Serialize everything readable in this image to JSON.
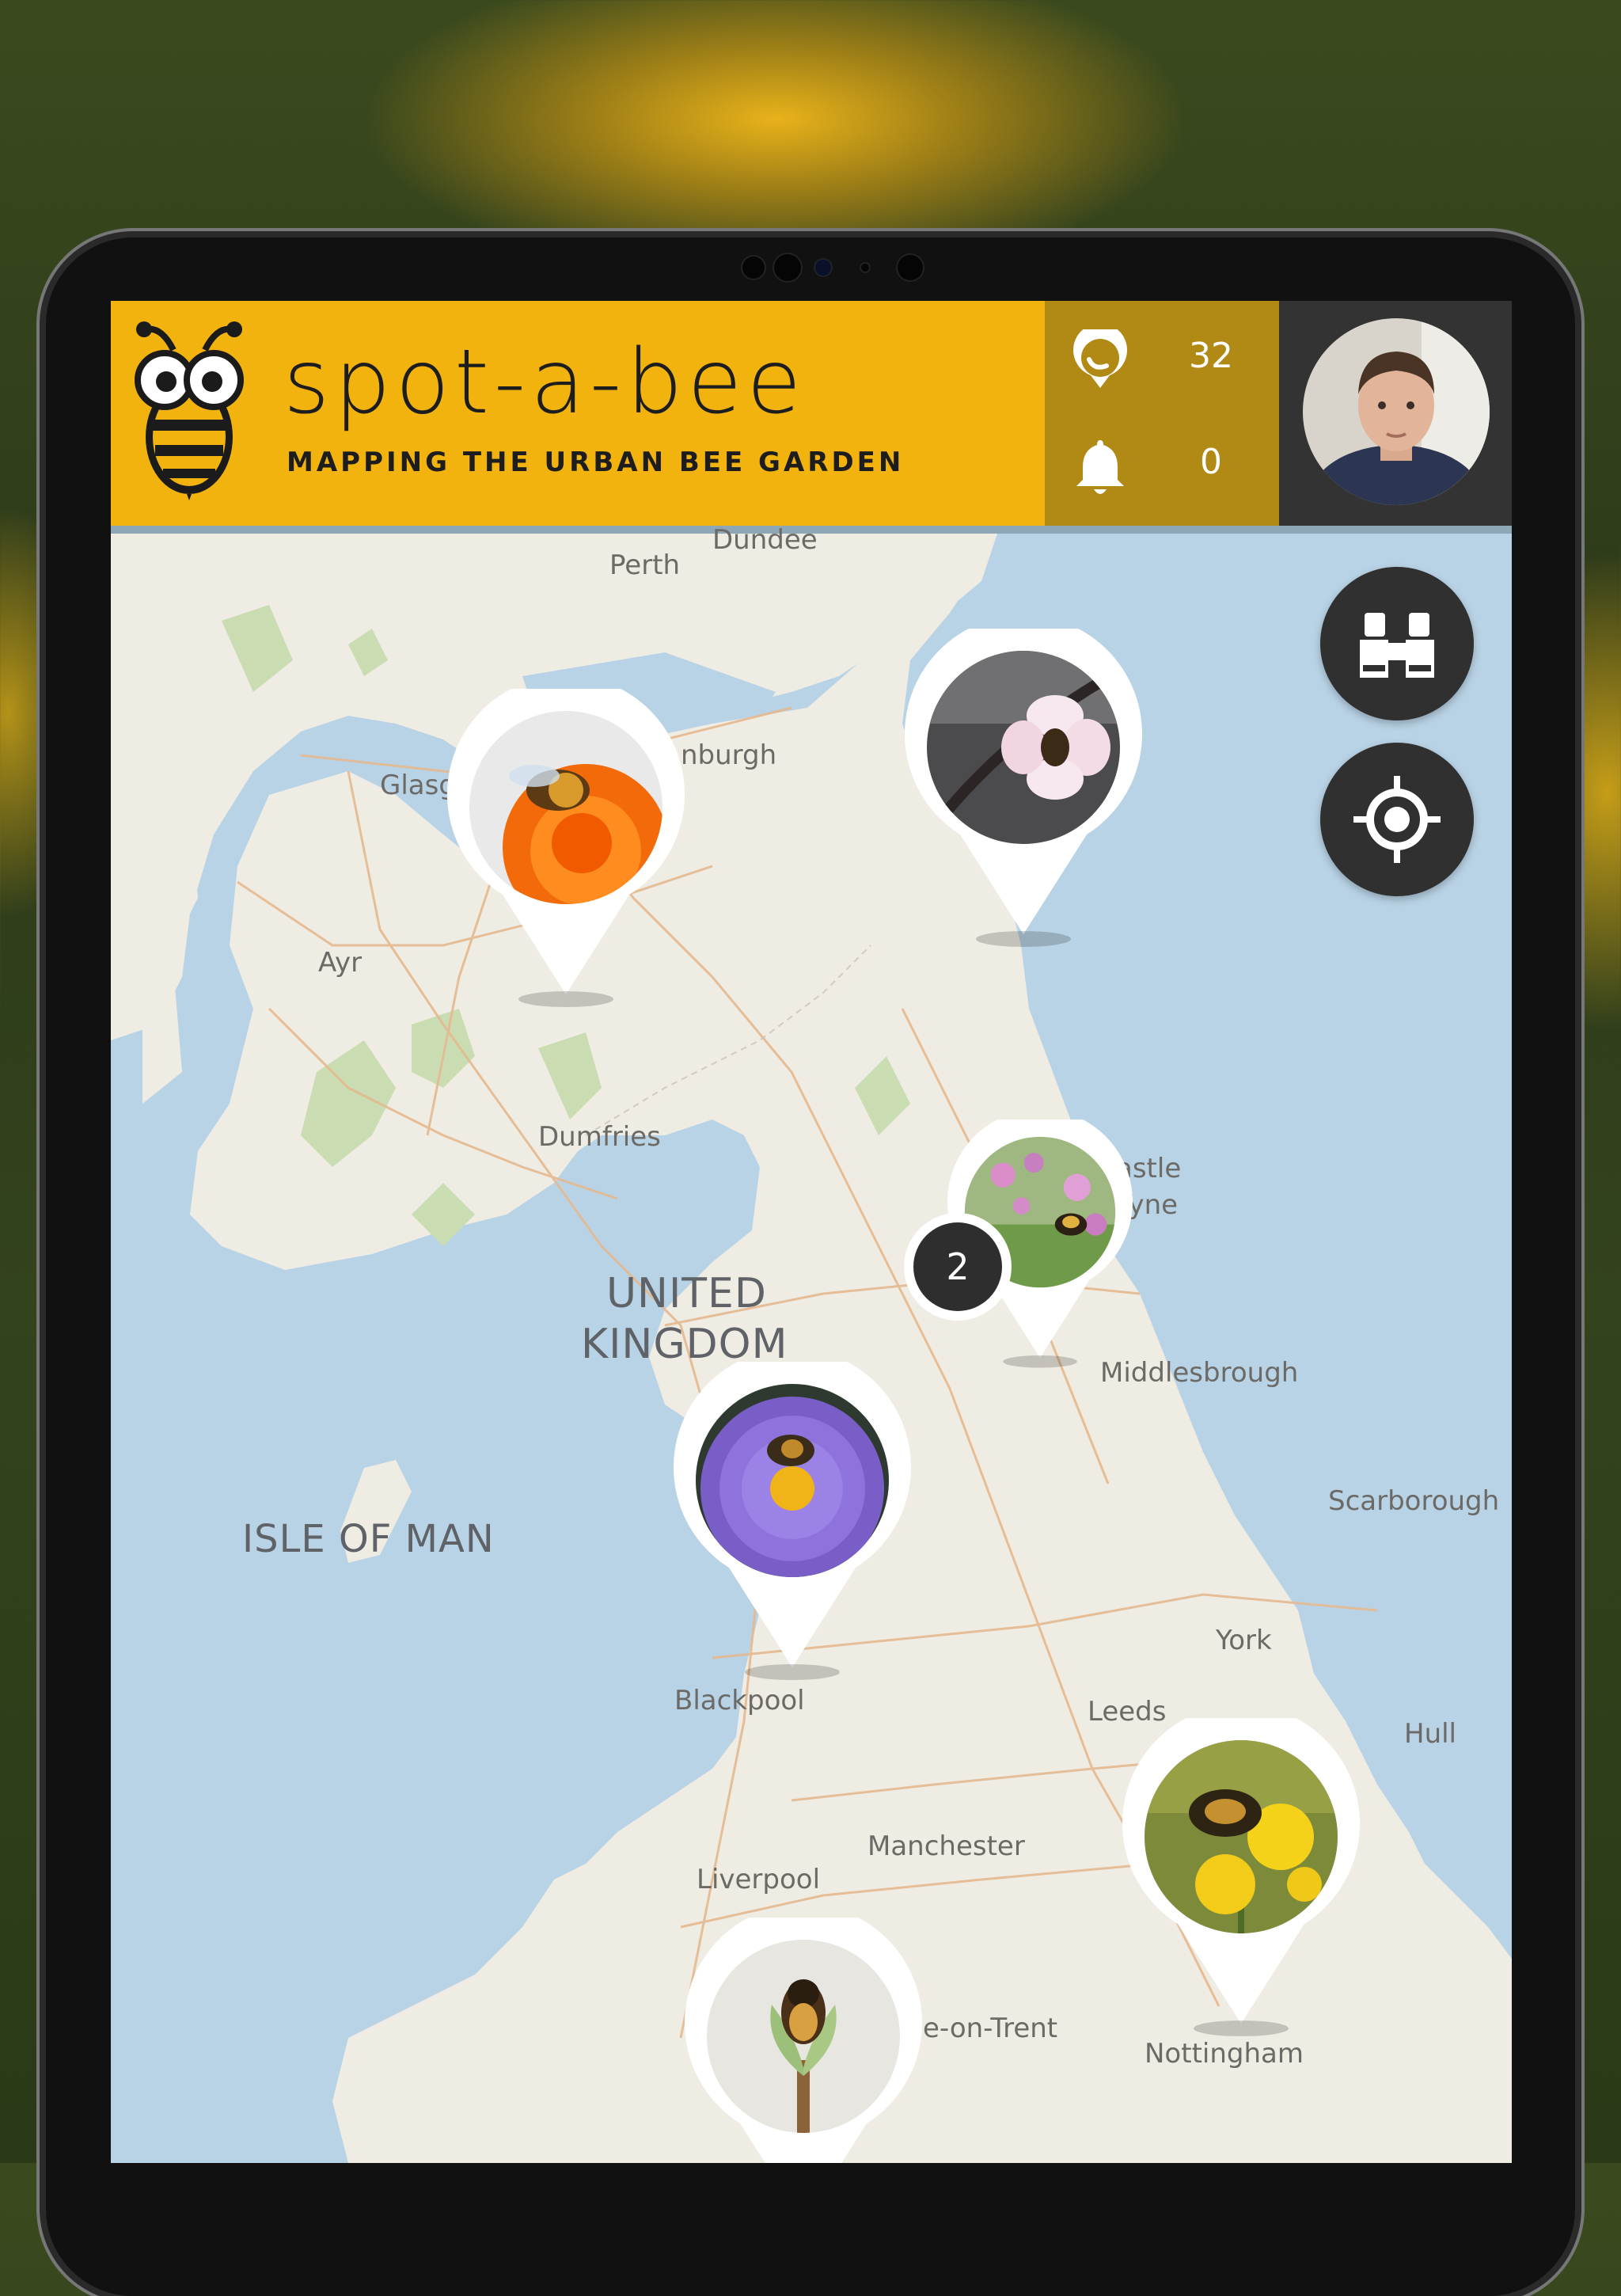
{
  "app": {
    "title": "spot-a-bee",
    "subtitle": "MAPPING THE URBAN BEE GARDEN"
  },
  "stats": {
    "sightings": {
      "icon": "sighting-pin-icon",
      "value": "32"
    },
    "notifications": {
      "icon": "bell-icon",
      "value": "0"
    }
  },
  "profile": {
    "avatar": "user-avatar"
  },
  "controls": {
    "explore": {
      "icon": "binoculars-icon"
    },
    "locate": {
      "icon": "crosshair-locate-icon"
    }
  },
  "map": {
    "places": {
      "dundee": "Dundee",
      "perth": "Perth",
      "edinburgh": "nburgh",
      "glasgow": "Glasg",
      "ayr": "Ayr",
      "dumfries": "Dumfries",
      "newcastle_a": "astle",
      "newcastle_b": "Tyne",
      "uk_a": "UNITED",
      "uk_b": "KINGDOM",
      "middlesbrough": "Middlesbrough",
      "isle_of_man": "ISLE OF MAN",
      "scarborough": "Scarborough",
      "york": "York",
      "blackpool": "Blackpool",
      "leeds": "Leeds",
      "hull": "Hull",
      "manchester": "Manchester",
      "liverpool": "Liverpool",
      "stoke": "e-on-Trent",
      "nottingham": "Nottingham"
    },
    "cluster_count": "2",
    "pins": [
      {
        "photo": "bee-on-orange-flower"
      },
      {
        "photo": "bee-on-blossom"
      },
      {
        "photo": "bee-on-pink-flowers"
      },
      {
        "photo": "bee-on-purple-aster"
      },
      {
        "photo": "bee-on-yellow-flowers"
      },
      {
        "photo": "bee-on-bud"
      }
    ]
  },
  "colors": {
    "brand_yellow": "#f2b30e",
    "stats_gold": "#b08a15",
    "profile_dark": "#333333",
    "fab_dark": "#303030"
  }
}
